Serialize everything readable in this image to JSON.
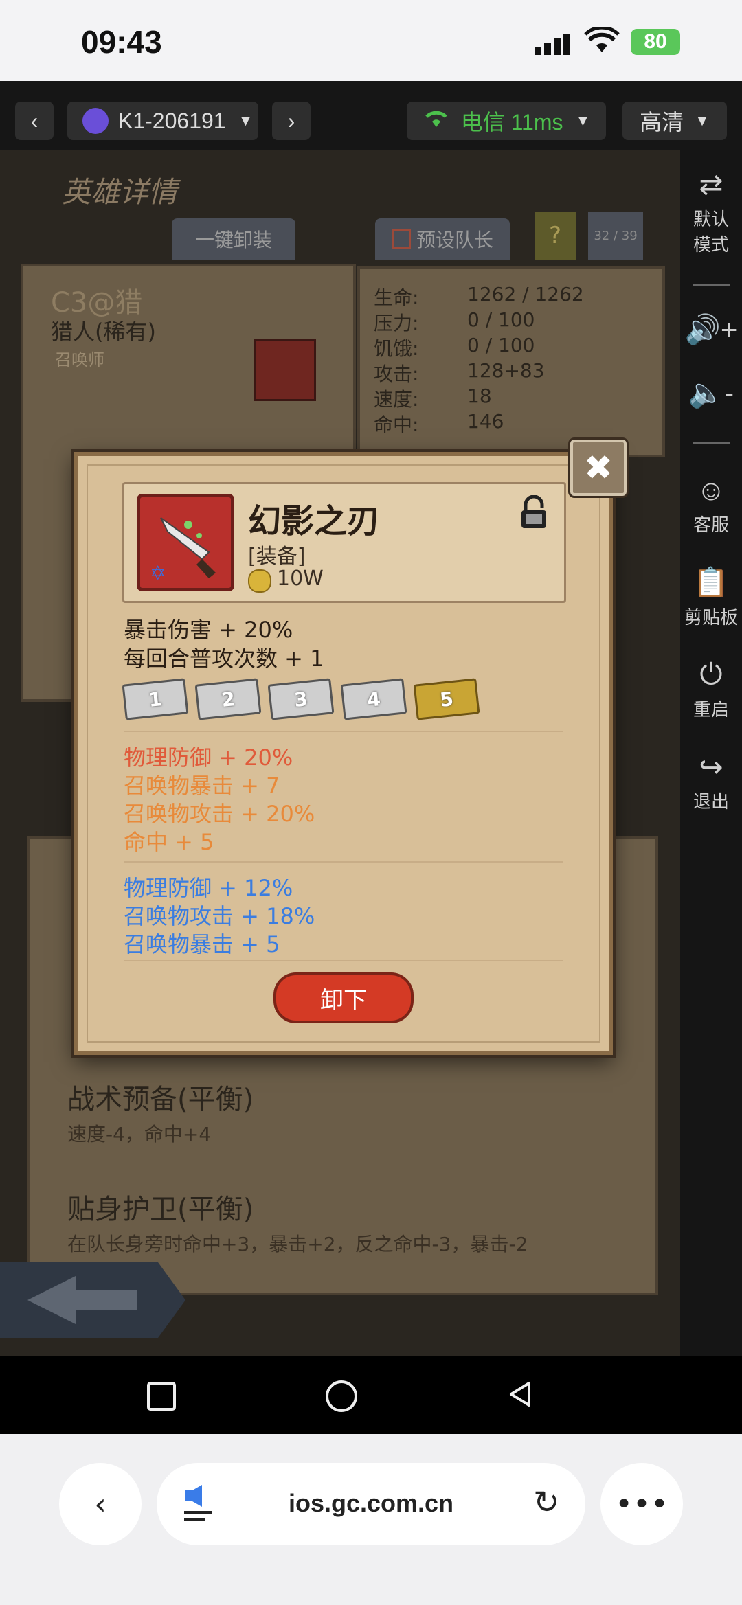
{
  "status_bar": {
    "time": "09:43",
    "battery": "80"
  },
  "toolbar": {
    "device_name": "K1-206191",
    "network_label": "电信 11ms",
    "quality_label": "高清"
  },
  "sidebar": {
    "items": [
      {
        "label": "默认\n模式",
        "icon": "swap-icon"
      },
      {
        "label": "",
        "icon": "volume-up-icon"
      },
      {
        "label": "",
        "icon": "volume-down-icon"
      },
      {
        "label": "客服",
        "icon": "support-icon"
      },
      {
        "label": "剪贴板",
        "icon": "clipboard-icon"
      },
      {
        "label": "重启",
        "icon": "power-icon"
      },
      {
        "label": "退出",
        "icon": "exit-icon"
      }
    ]
  },
  "game_bg": {
    "page_title": "英雄详情",
    "one_click_unequip": "一键卸装",
    "preset_leader": "预设队长",
    "help": "?",
    "count": "32 / 39",
    "hero_name": "C3@猎",
    "hero_class": "猎人(稀有)",
    "hero_role": "召唤师",
    "stats": [
      {
        "label": "生命:",
        "value": "1262 / 1262"
      },
      {
        "label": "压力:",
        "value": "0 / 100"
      },
      {
        "label": "饥饿:",
        "value": "0 / 100"
      },
      {
        "label": "攻击:",
        "value": "128+83"
      },
      {
        "label": "速度:",
        "value": "18"
      },
      {
        "label": "命中:",
        "value": "146"
      }
    ],
    "traits": [
      {
        "name": "战术预备(平衡)",
        "desc": "速度-4，命中+4"
      },
      {
        "name": "贴身护卫(平衡)",
        "desc": "在队长身旁时命中+3，暴击+2，反之命中-3，暴击-2"
      }
    ]
  },
  "item": {
    "name": "幻影之刃",
    "type": "[装备]",
    "price": "10W",
    "base_stats": [
      "暴击伤害 + 20%",
      "每回合普攻次数 + 1"
    ],
    "tiers": [
      "1",
      "2",
      "3",
      "4",
      "5"
    ],
    "orange_stats": [
      {
        "text": "物理防御 + 20%",
        "color": "#e05a3a"
      },
      {
        "text": "召唤物暴击 + 7",
        "color": "#e88a3a"
      },
      {
        "text": "召唤物攻击 + 20%",
        "color": "#e88a3a"
      },
      {
        "text": "命中 + 5",
        "color": "#e88a3a"
      }
    ],
    "blue_stats": [
      {
        "text": "物理防御 + 12%",
        "color": "#3b7de0"
      },
      {
        "text": "召唤物攻击 + 18%",
        "color": "#3b7de0"
      },
      {
        "text": "召唤物暴击 + 5",
        "color": "#3b7de0"
      }
    ],
    "unequip_label": "卸下"
  },
  "browser": {
    "url": "ios.gc.com.cn"
  }
}
